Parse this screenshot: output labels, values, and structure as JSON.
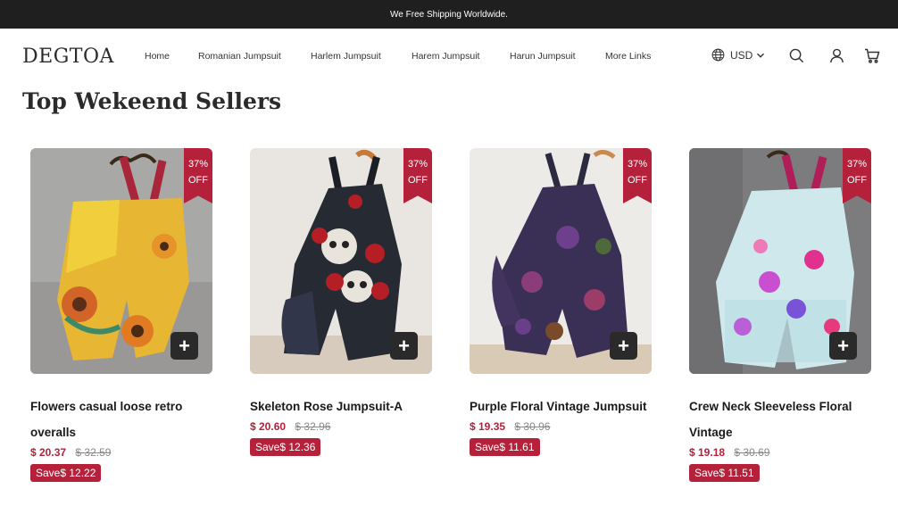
{
  "announcement": "We Free Shipping Worldwide.",
  "header": {
    "logo": "DEGTOA",
    "nav": [
      "Home",
      "Romanian Jumpsuit",
      "Harlem Jumpsuit",
      "Harem Jumpsuit",
      "Harun Jumpsuit",
      "More Links"
    ],
    "currency": "USD",
    "icons": [
      "globe-icon",
      "chevron-down-icon",
      "search-icon",
      "user-icon",
      "cart-icon"
    ]
  },
  "section": {
    "title": "Top Wekeend Sellers"
  },
  "products": [
    {
      "discount": "37%",
      "discount_suffix": "OFF",
      "title": "Flowers casual loose retro overalls",
      "price": "$ 20.37",
      "old_price": "$ 32.59",
      "save": "Save$ 12.22",
      "image_icon": "sunflower-jumpsuit-image"
    },
    {
      "discount": "37%",
      "discount_suffix": "OFF",
      "title": "Skeleton Rose Jumpsuit-A",
      "price": "$ 20.60",
      "old_price": "$ 32.96",
      "save": "Save$ 12.36",
      "image_icon": "skull-rose-jumpsuit-image"
    },
    {
      "discount": "37%",
      "discount_suffix": "OFF",
      "title": "Purple Floral Vintage Jumpsuit",
      "price": "$ 19.35",
      "old_price": "$ 30.96",
      "save": "Save$ 11.61",
      "image_icon": "purple-floral-jumpsuit-image"
    },
    {
      "discount": "37%",
      "discount_suffix": "OFF",
      "title": "Crew Neck Sleeveless Floral Vintage",
      "price": "$ 19.18",
      "old_price": "$ 30.69",
      "save": "Save$ 11.51",
      "image_icon": "light-floral-jumpsuit-image"
    }
  ],
  "colors": {
    "accent": "#b5213a",
    "topbar": "#1f1f1f",
    "dark_button": "#2a2a2a"
  }
}
